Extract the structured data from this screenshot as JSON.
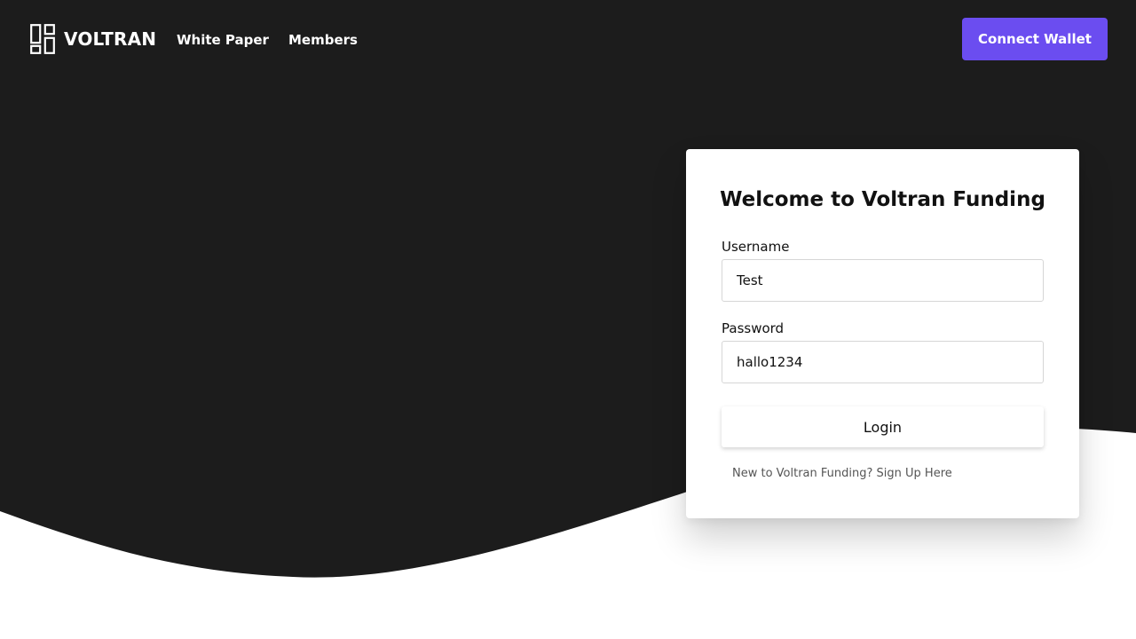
{
  "brand": {
    "name": "VOLTRAN",
    "logo_icon": "dashboard-grid-icon"
  },
  "nav": {
    "links": [
      {
        "label": "White Paper"
      },
      {
        "label": "Members"
      }
    ],
    "connect_wallet_label": "Connect Wallet"
  },
  "login_card": {
    "title": "Welcome to Voltran Funding",
    "username": {
      "label": "Username",
      "value": "Test"
    },
    "password": {
      "label": "Password",
      "value": "hallo1234"
    },
    "login_label": "Login",
    "signup_text": "New to Voltran Funding? Sign Up Here"
  },
  "colors": {
    "hero_background": "#1c1c1c",
    "accent": "#6b4df0",
    "page_background": "#ffffff"
  }
}
